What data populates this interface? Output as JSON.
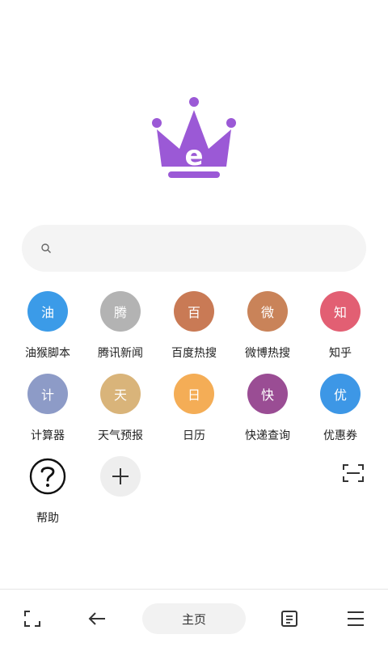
{
  "logo": {
    "letter": "e",
    "color": "#9b59d6"
  },
  "search": {
    "placeholder": ""
  },
  "shortcuts": [
    {
      "label": "油猴脚本",
      "glyph": "油",
      "color": "#3b9be8"
    },
    {
      "label": "腾讯新闻",
      "glyph": "腾",
      "color": "#b3b3b3"
    },
    {
      "label": "百度热搜",
      "glyph": "百",
      "color": "#c97a55"
    },
    {
      "label": "微博热搜",
      "glyph": "微",
      "color": "#c98359"
    },
    {
      "label": "知乎",
      "glyph": "知",
      "color": "#e25f73"
    },
    {
      "label": "计算器",
      "glyph": "计",
      "color": "#8d9bc7"
    },
    {
      "label": "天气预报",
      "glyph": "天",
      "color": "#d9b47a"
    },
    {
      "label": "日历",
      "glyph": "日",
      "color": "#f4ad56"
    },
    {
      "label": "快递查询",
      "glyph": "快",
      "color": "#9a4d94"
    },
    {
      "label": "优惠券",
      "glyph": "优",
      "color": "#3d97e6"
    },
    {
      "label": "帮助",
      "glyph": "",
      "color": ""
    }
  ],
  "bottom": {
    "home_label": "主页"
  }
}
